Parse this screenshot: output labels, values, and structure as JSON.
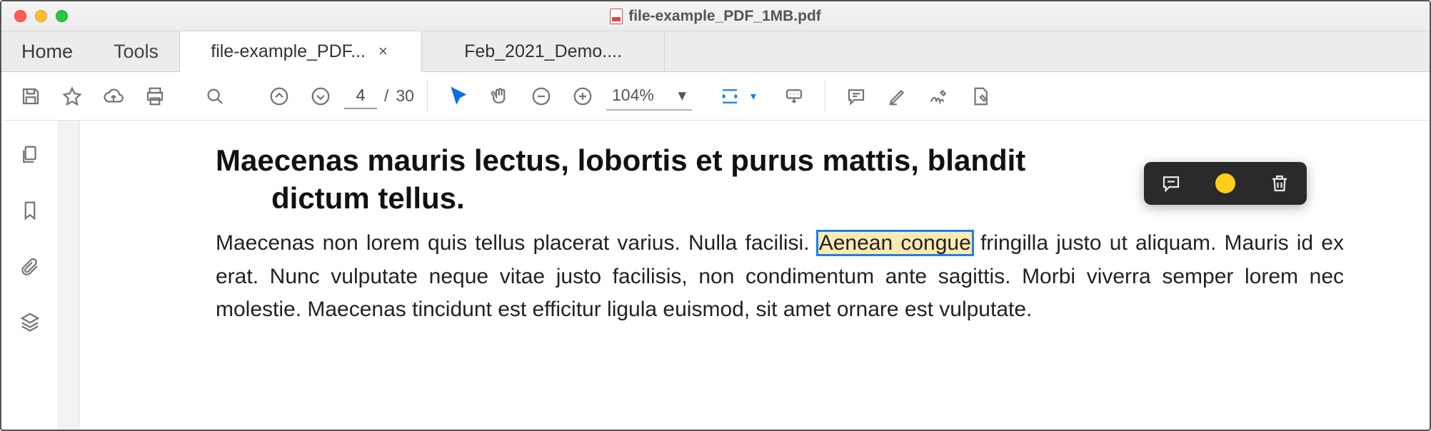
{
  "window": {
    "title": "file-example_PDF_1MB.pdf"
  },
  "tabstrip": {
    "home": "Home",
    "tools": "Tools",
    "docs": [
      {
        "label": "file-example_PDF...",
        "active": true,
        "closable": true
      },
      {
        "label": "Feb_2021_Demo....",
        "active": false,
        "closable": false
      }
    ]
  },
  "toolbar": {
    "page_current": "4",
    "page_sep": "/",
    "page_total": "30",
    "zoom_value": "104%"
  },
  "document": {
    "heading_line1": "Maecenas mauris lectus, lobortis et purus mattis, blandit",
    "heading_line2": "dictum tellus.",
    "body_pre": "Maecenas non lorem quis tellus placerat varius. Nulla facilisi. ",
    "body_hl": "Aenean congue",
    "body_rest": " fringilla justo ut aliquam. Mauris id ex erat. Nunc vulputate neque vitae justo facilisis, non condimentum ante sagittis. Morbi viverra semper lorem nec molestie. Maecenas tincidunt est efficitur ligula euismod, sit amet ornare est vulputate."
  },
  "highlight_popup": {
    "color": "#ffcf1a"
  }
}
